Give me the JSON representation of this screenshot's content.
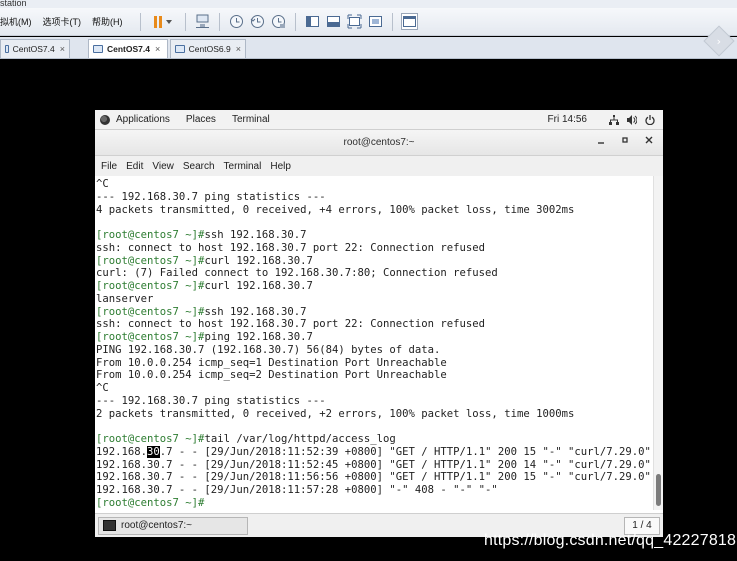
{
  "host": {
    "window_title": "station",
    "menus": [
      "拟机(M)",
      "选项卡(T)",
      "帮助(H)"
    ],
    "tabs": [
      {
        "label": "CentOS7.4",
        "active": false
      },
      {
        "label": "CentOS7.4",
        "active": true
      },
      {
        "label": "CentOS6.9",
        "active": false
      }
    ],
    "close_glyph": "×"
  },
  "gnome": {
    "applications_label": "Applications",
    "places_label": "Places",
    "terminal_label": "Terminal",
    "clock": "Fri 14:56"
  },
  "terminal": {
    "title": "root@centos7:~",
    "menu": [
      "File",
      "Edit",
      "View",
      "Search",
      "Terminal",
      "Help"
    ],
    "lines": [
      {
        "text": "^C"
      },
      {
        "text": "--- 192.168.30.7 ping statistics ---"
      },
      {
        "text": "4 packets transmitted, 0 received, +4 errors, 100% packet loss, time 3002ms"
      },
      {
        "text": ""
      },
      {
        "prompt": "[root@centos7 ~]#",
        "text": "ssh 192.168.30.7"
      },
      {
        "text": "ssh: connect to host 192.168.30.7 port 22: Connection refused"
      },
      {
        "prompt": "[root@centos7 ~]#",
        "text": "curl 192.168.30.7"
      },
      {
        "text": "curl: (7) Failed connect to 192.168.30.7:80; Connection refused"
      },
      {
        "prompt": "[root@centos7 ~]#",
        "text": "curl 192.168.30.7"
      },
      {
        "text": "lanserver"
      },
      {
        "prompt": "[root@centos7 ~]#",
        "text": "ssh 192.168.30.7"
      },
      {
        "text": "ssh: connect to host 192.168.30.7 port 22: Connection refused"
      },
      {
        "prompt": "[root@centos7 ~]#",
        "text": "ping 192.168.30.7"
      },
      {
        "text": "PING 192.168.30.7 (192.168.30.7) 56(84) bytes of data."
      },
      {
        "text": "From 10.0.0.254 icmp_seq=1 Destination Port Unreachable"
      },
      {
        "text": "From 10.0.0.254 icmp_seq=2 Destination Port Unreachable"
      },
      {
        "text": "^C"
      },
      {
        "text": "--- 192.168.30.7 ping statistics ---"
      },
      {
        "text": "2 packets transmitted, 0 received, +2 errors, 100% packet loss, time 1000ms"
      },
      {
        "text": ""
      },
      {
        "prompt": "[root@centos7 ~]#",
        "text": "tail /var/log/httpd/access_log"
      },
      {
        "pre": "192.168.",
        "highlight": "30",
        "text": ".7 - - [29/Jun/2018:11:52:39 +0800] \"GET / HTTP/1.1\" 200 15 \"-\" \"curl/7.29.0\""
      },
      {
        "text": "192.168.30.7 - - [29/Jun/2018:11:52:45 +0800] \"GET / HTTP/1.1\" 200 14 \"-\" \"curl/7.29.0\""
      },
      {
        "text": "192.168.30.7 - - [29/Jun/2018:11:56:56 +0800] \"GET / HTTP/1.1\" 200 15 \"-\" \"curl/7.29.0\""
      },
      {
        "text": "192.168.30.7 - - [29/Jun/2018:11:57:28 +0800] \"-\" 408 - \"-\" \"-\""
      },
      {
        "prompt": "[root@centos7 ~]#",
        "text": ""
      }
    ]
  },
  "taskbar": {
    "task_label": "root@centos7:~",
    "workspace": "1 / 4"
  },
  "watermark": "https://blog.csdn.net/qq_42227818"
}
